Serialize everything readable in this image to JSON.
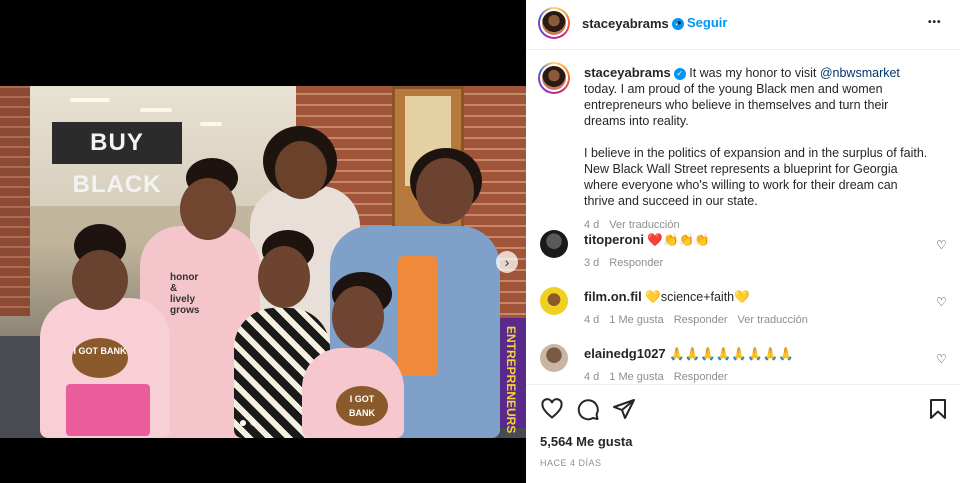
{
  "post": {
    "username": "staceyabrams",
    "follow_label": "Seguir",
    "sep": "•",
    "more_label": "•••",
    "caption_p1_a": "It was my honor to visit ",
    "caption_mention": "@nbwsmarket",
    "caption_p1_b": " today. I am proud of the young Black men and women entrepreneurs who believe in themselves and turn their dreams into reality.",
    "caption_p2": "I believe in the politics of expansion and in the surplus of faith. New Black Wall Street represents a blueprint for Georgia where everyone who's willing to work for their dream can thrive and succeed in our state.",
    "caption_age": "4 d",
    "see_translation": "Ver traducción",
    "likes": "5,564 Me gusta",
    "date": "HACE 4 DÍAS"
  },
  "photo": {
    "sign_text": "BUY BLACK",
    "banner_text": "ENTREPRENEURS",
    "tee_text": "I GOT BANK",
    "shirt_text": "honor & lively grows",
    "next_arrow": "›"
  },
  "comments": [
    {
      "user": "titoperoni",
      "text": "❤️👏👏👏",
      "age": "3 d",
      "likes": "",
      "reply": "Responder",
      "translate": ""
    },
    {
      "user": "film.on.fil",
      "text": "💛science+faith💛",
      "age": "4 d",
      "likes": "1 Me gusta",
      "reply": "Responder",
      "translate": "Ver traducción"
    },
    {
      "user": "elainedg1027",
      "text": "🙏🙏🙏🙏🙏🙏🙏🙏",
      "age": "4 d",
      "likes": "1 Me gusta",
      "reply": "Responder",
      "translate": ""
    }
  ],
  "colors": {
    "accent": "#0095f6",
    "mention": "#00376b",
    "muted": "#8e8e8e"
  }
}
